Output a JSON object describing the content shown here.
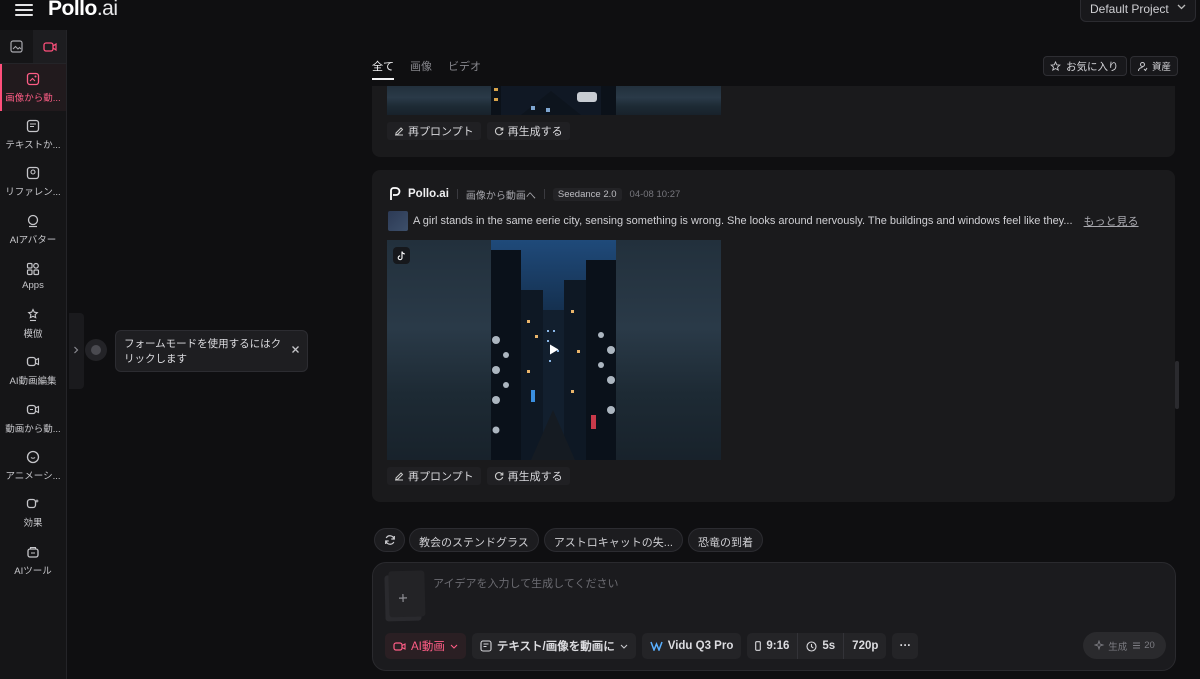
{
  "app": {
    "logo_main": "Pollo",
    "logo_suffix": ".ai",
    "project": "Default Project"
  },
  "sidebar": {
    "tabs": [
      {
        "icon": "image-icon"
      },
      {
        "icon": "video-icon"
      }
    ],
    "items": [
      {
        "label": "画像から動...",
        "icon": "image-to-video-icon",
        "active": true
      },
      {
        "label": "テキストか...",
        "icon": "text-to-video-icon"
      },
      {
        "label": "リファレン...",
        "icon": "reference-icon"
      },
      {
        "label": "AIアバター",
        "icon": "avatar-icon"
      },
      {
        "label": "Apps",
        "icon": "apps-icon"
      },
      {
        "label": "模倣",
        "icon": "imitate-icon"
      },
      {
        "label": "AI動画編集",
        "icon": "video-edit-icon"
      },
      {
        "label": "動画から動...",
        "icon": "video-to-video-icon"
      },
      {
        "label": "アニメーシ...",
        "icon": "animation-icon"
      },
      {
        "label": "効果",
        "icon": "effects-icon"
      },
      {
        "label": "AIツール",
        "icon": "ai-tools-icon"
      }
    ]
  },
  "hint": {
    "text": "フォームモードを使用するにはクリックします"
  },
  "filters": {
    "tabs": [
      "全て",
      "画像",
      "ビデオ"
    ],
    "active": "全て"
  },
  "header_actions": {
    "favorites": "お気に入り",
    "assets": "資産"
  },
  "actions": {
    "reprompt": "再プロンプト",
    "regenerate": "再生成する"
  },
  "card": {
    "brand": "Pollo.ai",
    "mode_tag": "画像から動画へ",
    "model": "Seedance 2.0",
    "date": "04-08 10:27",
    "prompt": "A girl stands in the same eerie city, sensing something is wrong. She looks around nervously. The buildings and windows feel like they...",
    "more": "もっと見る"
  },
  "suggestions": [
    "教会のステンドグラス",
    "アストロキャットの失...",
    "恐竜の到着"
  ],
  "composer": {
    "placeholder": "アイデアを入力して生成してください",
    "ai_mode": "AI動画",
    "mode": "テキスト/画像を動画に",
    "model": "Vidu Q3 Pro",
    "ratio": "9:16",
    "duration": "5s",
    "resolution": "720p",
    "more": "···",
    "generate": "生成",
    "credits": "20"
  },
  "colors": {
    "accent": "#ff4f7b",
    "background": "#0f0f11",
    "card": "#1a1a1c"
  }
}
